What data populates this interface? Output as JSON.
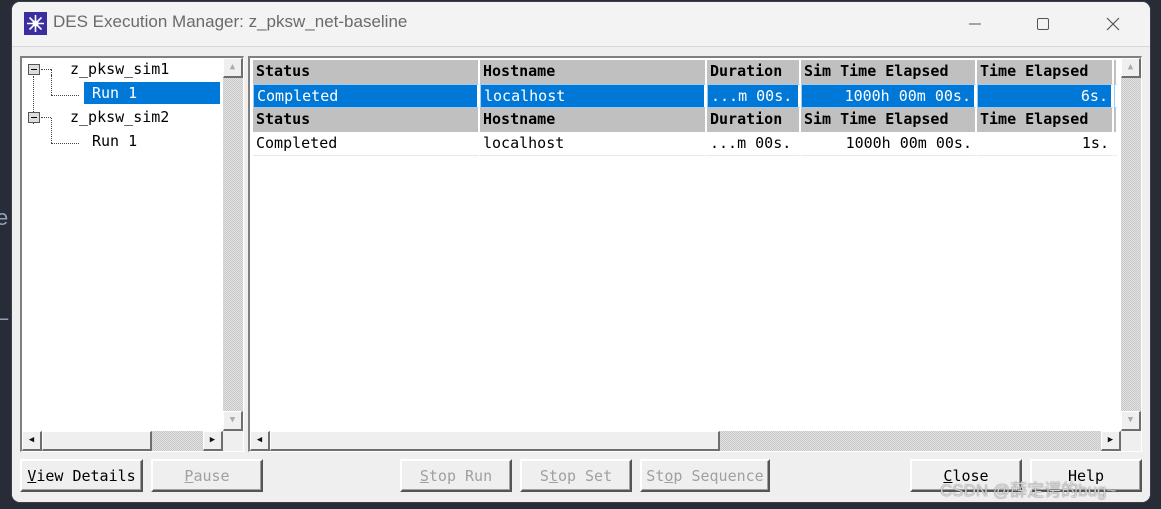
{
  "window": {
    "title": "DES Execution Manager: z_pksw_net-baseline",
    "controls": {
      "minimize": "—",
      "maximize": "☐",
      "close": "✕"
    }
  },
  "tree": {
    "nodes": [
      {
        "label": "z_pksw_sim1",
        "expanded": true,
        "children": [
          {
            "label": "Run 1",
            "selected": true
          }
        ]
      },
      {
        "label": "z_pksw_sim2",
        "expanded": true,
        "children": [
          {
            "label": "Run 1",
            "selected": false
          }
        ]
      }
    ]
  },
  "grid": {
    "headers": [
      "Status",
      "Hostname",
      "Duration",
      "Sim Time Elapsed",
      "Time Elapsed"
    ],
    "groups": [
      {
        "row": {
          "status": "Completed",
          "hostname": "localhost",
          "duration": "...m 00s.",
          "sim_time": "1000h 00m 00s.",
          "time": "6s.",
          "selected": true
        }
      },
      {
        "row": {
          "status": "Completed",
          "hostname": "localhost",
          "duration": "...m 00s.",
          "sim_time": "1000h 00m 00s.",
          "time": "1s.",
          "selected": false
        }
      }
    ]
  },
  "scroll": {
    "up": "▲",
    "down": "▼",
    "left": "◀",
    "right": "▶"
  },
  "buttons": {
    "view_details": {
      "pre": "",
      "key": "V",
      "post": "iew Details"
    },
    "pause": {
      "pre": "",
      "key": "P",
      "post": "ause"
    },
    "stop_run": {
      "pre": "",
      "key": "S",
      "post": "top Run"
    },
    "stop_set": {
      "pre": "S",
      "key": "t",
      "post": "op Set"
    },
    "stop_sequence": {
      "pre": "St",
      "key": "o",
      "post": "p Sequence"
    },
    "close": {
      "pre": "",
      "key": "C",
      "post": "lose"
    },
    "help": {
      "pre": "",
      "key": "",
      "post": "Help"
    }
  },
  "watermark": "CSDN @薛定谔的bug~",
  "background_fragments": {
    "e": "e",
    "dash": "–"
  }
}
